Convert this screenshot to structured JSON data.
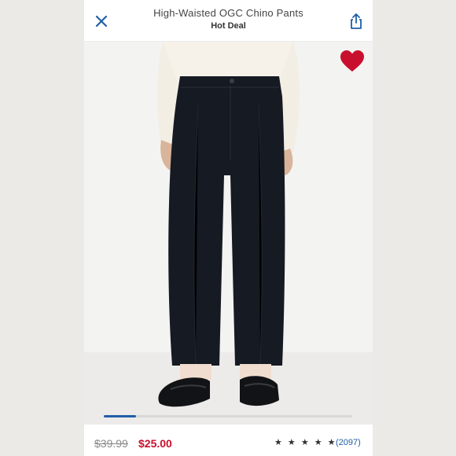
{
  "header": {
    "title": "High-Waisted OGC Chino Pants",
    "subtitle": "Hot Deal",
    "close_icon": "close-icon",
    "share_icon": "share-icon"
  },
  "product_image": {
    "description_icon": "product-photo",
    "favorite_icon": "heart-icon",
    "favorite_color": "#c8102e",
    "carousel_progress": 0.13
  },
  "pricing": {
    "original_price": "$39.99",
    "sale_price": "$25.00",
    "sale_color": "#c8102e"
  },
  "rating": {
    "stars": "★ ★ ★ ★ ★",
    "value": 4.5,
    "review_count": "(2097)",
    "link_color": "#1f5ea8"
  }
}
